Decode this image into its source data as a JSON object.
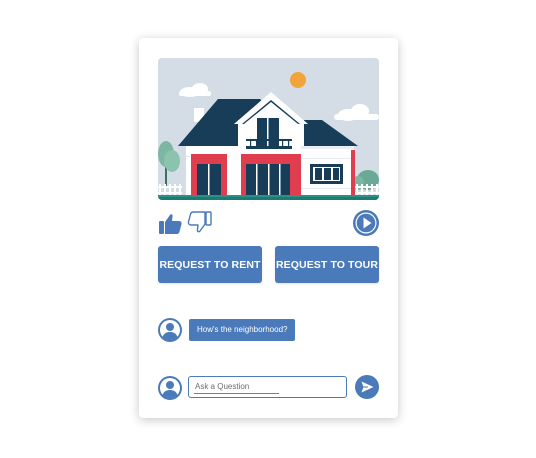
{
  "listing": {
    "image_icon": "house-illustration"
  },
  "reactions": {
    "like_icon": "thumbs-up-icon",
    "dislike_icon": "thumbs-down-icon",
    "play_icon": "play-icon"
  },
  "actions": {
    "rent_label": "REQUEST TO RENT",
    "tour_label": "REQUEST TO TOUR"
  },
  "chat": {
    "messages": [
      {
        "sender": "avatar",
        "text": "How's the neighborhood?"
      }
    ],
    "input_placeholder": "Ask a Question",
    "input_value": "",
    "send_icon": "send-icon"
  },
  "colors": {
    "accent": "#4a7ab9",
    "roof": "#173d58",
    "wall": "#ffffff",
    "door_red": "#e03d4f",
    "sky": "#d4dde6",
    "sun": "#f2a33a",
    "tree": "#7db7a3"
  }
}
